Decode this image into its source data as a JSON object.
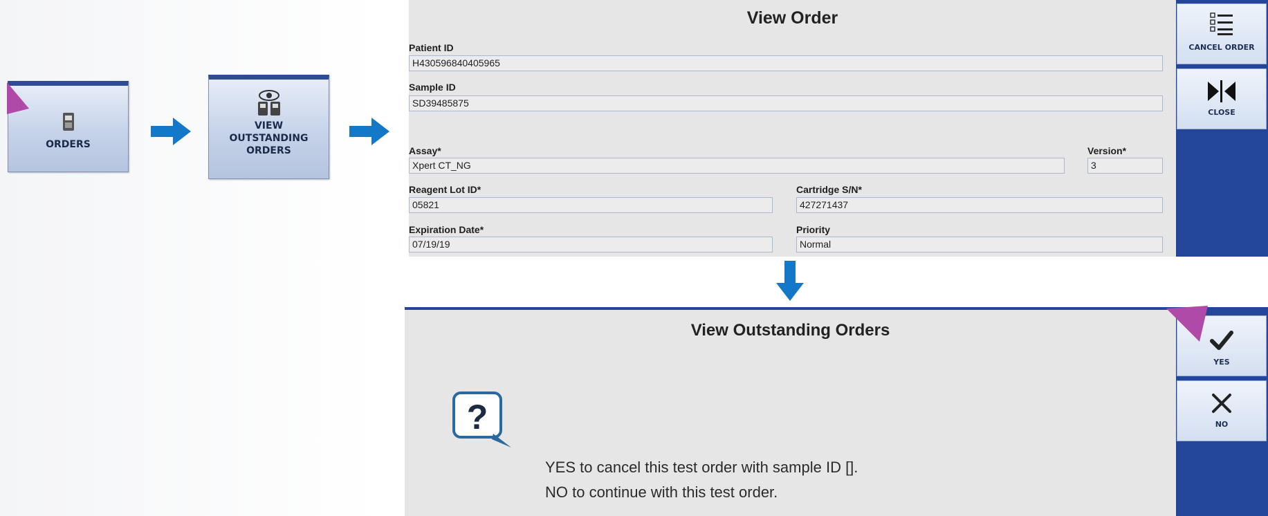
{
  "workflow": {
    "orders_tile": {
      "label": "ORDERS",
      "icon": "orders-icon"
    },
    "view_outstanding_tile": {
      "label_lines": [
        "VIEW",
        "OUTSTANDING",
        "ORDERS"
      ],
      "icon": "view-orders-icon"
    }
  },
  "view_order": {
    "title": "View Order",
    "fields": {
      "patient_id": {
        "label": "Patient ID",
        "value": "H430596840405965"
      },
      "sample_id": {
        "label": "Sample ID",
        "value": "SD39485875"
      },
      "assay": {
        "label": "Assay*",
        "value": "Xpert CT_NG"
      },
      "version": {
        "label": "Version*",
        "value": "3"
      },
      "reagent_lot": {
        "label": "Reagent Lot ID*",
        "value": "05821"
      },
      "cartridge_sn": {
        "label": "Cartridge S/N*",
        "value": "427271437"
      },
      "expiration": {
        "label": "Expiration Date*",
        "value": "07/19/19"
      },
      "priority": {
        "label": "Priority",
        "value": "Normal"
      }
    },
    "sidebar": {
      "cancel_order": "CANCEL ORDER",
      "close": "CLOSE"
    }
  },
  "outstanding_dialog": {
    "title": "View Outstanding Orders",
    "message_lines": [
      "YES to cancel this test order with sample ID [].",
      "NO to continue with this test order."
    ],
    "sidebar": {
      "yes": "YES",
      "no": "NO"
    }
  },
  "colors": {
    "accent_blue": "#24469a",
    "arrow_blue": "#1478c8",
    "pointer_magenta": "#b04aa8"
  }
}
